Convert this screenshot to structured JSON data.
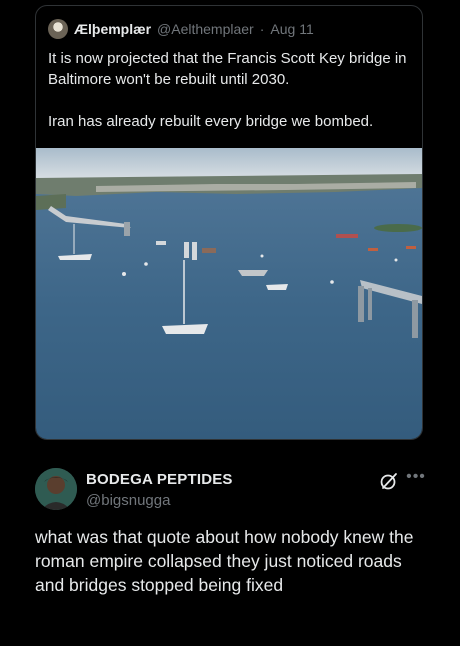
{
  "quoted_post": {
    "display_name": "Ælþemplær",
    "handle": "@Aelthemplaer",
    "separator": "·",
    "date": "Aug 11",
    "paragraphs": [
      "It is now projected that the Francis Scott Key bridge in Baltimore won't be rebuilt until 2030.",
      "Iran has already rebuilt every bridge we bombed."
    ],
    "image_alt": "Aerial photo of the collapsed Francis Scott Key Bridge in Baltimore harbor with boats on the water"
  },
  "reply": {
    "display_name": "BODEGA PEPTIDES",
    "handle": "@bigsnugga",
    "text": "what was that quote about how nobody knew the roman empire collapsed they just noticed roads and bridges stopped being fixed",
    "icons": [
      "grok-icon",
      "more-icon"
    ]
  },
  "colors": {
    "background": "#000000",
    "primary_text": "#e7e9ea",
    "secondary_text": "#71767b",
    "border": "#2f3336",
    "water": "#3d6688"
  }
}
